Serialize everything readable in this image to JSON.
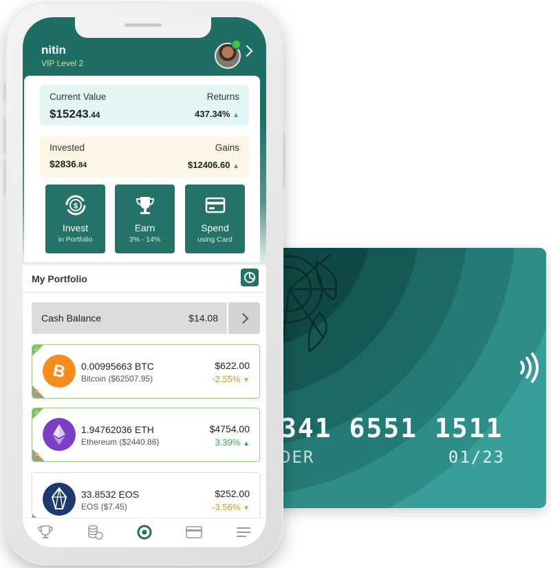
{
  "card": {
    "number": "341 6551 1511",
    "holder": "DER",
    "expiry": "01/23",
    "accent": "#3a9e98"
  },
  "user": {
    "name": "nitin",
    "level": "VIP Level 2"
  },
  "summary": {
    "current_value_label": "Current Value",
    "current_value": "$15243",
    "current_value_cents": ".44",
    "returns_label": "Returns",
    "returns": "437.34%",
    "invested_label": "Invested",
    "invested": "$2836",
    "invested_cents": ".84",
    "gains_label": "Gains",
    "gains": "$12406.60"
  },
  "actions": [
    {
      "title": "Invest",
      "sub": "in Portfolio",
      "icon": "dollar-cycle-icon"
    },
    {
      "title": "Earn",
      "sub": "3% - 14%",
      "icon": "trophy-icon"
    },
    {
      "title": "Spend",
      "sub": "using Card",
      "icon": "credit-card-icon"
    }
  ],
  "portfolio": {
    "title": "My Portfolio",
    "cash_label": "Cash Balance",
    "cash_value": "$14.08",
    "coins": [
      {
        "amount": "0.00995663 BTC",
        "name": "Bitcoin ($62507.95)",
        "usd": "$622.00",
        "change": "-2.55%",
        "icon": "bitcoin-icon",
        "color": "#f58d1e"
      },
      {
        "amount": "1.94762036 ETH",
        "name": "Ethereum ($2440.86)",
        "usd": "$4754.00",
        "change": "3.39%",
        "icon": "ethereum-icon",
        "color": "#7b3fc4"
      },
      {
        "amount": "33.8532 EOS",
        "name": "EOS ($7.45)",
        "usd": "$252.00",
        "change": "-3.56%",
        "icon": "eos-icon",
        "color": "#1d3a6e"
      }
    ]
  },
  "tabs": [
    "trophy-icon",
    "coins-icon",
    "home-icon",
    "card-icon",
    "menu-icon"
  ],
  "colors": {
    "brand": "#1f6e66",
    "positive": "#3ea84a",
    "negative": "#cf9c23"
  }
}
